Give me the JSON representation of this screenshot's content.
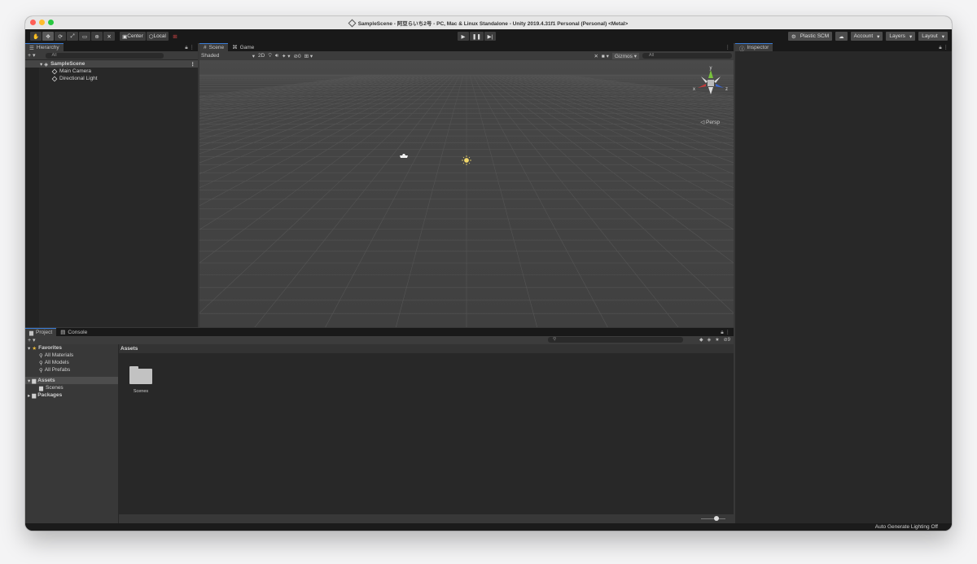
{
  "window": {
    "title": "SampleScene - 阿豆らいち2号 - PC, Mac & Linux Standalone - Unity 2019.4.31f1 Personal (Personal) <Metal>"
  },
  "toolbar": {
    "tools": [
      "hand-tool",
      "move-tool",
      "rotate-tool",
      "scale-tool",
      "rect-tool",
      "transform-tool",
      "custom-tool"
    ],
    "pivot_label": "Center",
    "space_label": "Local",
    "plastic_label": "Plastic SCM",
    "account_label": "Account",
    "layers_label": "Layers",
    "layout_label": "Layout"
  },
  "hierarchy": {
    "tab_label": "Hierarchy",
    "search_placeholder": "All",
    "scene_name": "SampleScene",
    "items": [
      {
        "label": "Main Camera"
      },
      {
        "label": "Directional Light"
      }
    ]
  },
  "scene": {
    "tabs": [
      {
        "label": "Scene",
        "active": true
      },
      {
        "label": "Game",
        "active": false
      }
    ],
    "shading_mode": "Shaded",
    "mode_2d_label": "2D",
    "hidden_count": "0",
    "gizmos_label": "Gizmos",
    "search_placeholder": "All",
    "projection_label": "Persp",
    "axis_labels": {
      "x": "x",
      "y": "y",
      "z": "z"
    }
  },
  "inspector": {
    "tab_label": "Inspector"
  },
  "project": {
    "tabs": [
      {
        "label": "Project",
        "active": true
      },
      {
        "label": "Console",
        "active": false
      }
    ],
    "hidden_count": "9",
    "favorites_label": "Favorites",
    "favorites": [
      {
        "label": "All Materials"
      },
      {
        "label": "All Models"
      },
      {
        "label": "All Prefabs"
      }
    ],
    "assets_label": "Assets",
    "asset_children": [
      {
        "label": "Scenes"
      }
    ],
    "packages_label": "Packages",
    "breadcrumb": "Assets",
    "folders": [
      {
        "label": "Scenes"
      }
    ]
  },
  "status": {
    "text": "Auto Generate Lighting Off"
  }
}
